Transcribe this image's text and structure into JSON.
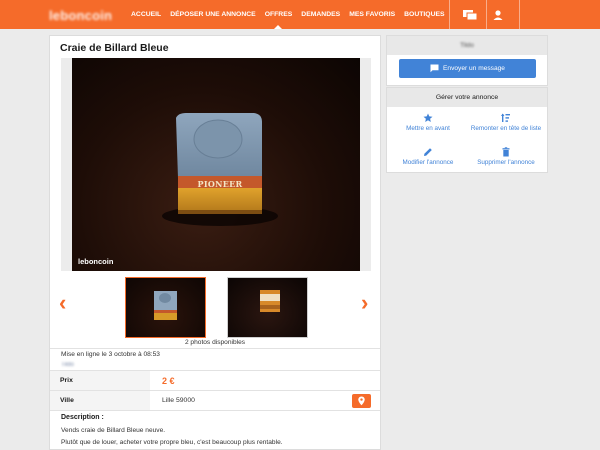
{
  "header": {
    "logo": "leboncoin",
    "nav": [
      "ACCUEIL",
      "DÉPOSER UNE ANNONCE",
      "OFFRES",
      "DEMANDES",
      "MES FAVORIS",
      "BOUTIQUES"
    ],
    "active_nav": "OFFRES",
    "icons": [
      "messages-icon",
      "user-icon"
    ]
  },
  "ad": {
    "title": "Craie de Billard Bleue",
    "photo_watermark": "leboncoin",
    "photo_text": "PIONEER",
    "photos_count": "2 photos disponibles",
    "published": "Mise en ligne le 3 octobre à 08:53",
    "seller_blur": "Tildo",
    "price_label": "Prix",
    "price": "2 €",
    "city_label": "Ville",
    "city": "Lille 59000",
    "description_title": "Description :",
    "description_lines": [
      "Vends craie de Billard Bleue neuve.",
      "Plutôt que de louer, acheter votre propre bleu, c'est beaucoup plus rentable."
    ]
  },
  "sidebar": {
    "seller_name": "Tildo",
    "message_button": "Envoyer un message",
    "manage_title": "Gérer votre annonce",
    "actions": [
      {
        "label": "Mettre en avant",
        "icon": "star-icon"
      },
      {
        "label": "Remonter en tête de liste",
        "icon": "sort-icon"
      },
      {
        "label": "Modifier l'annonce",
        "icon": "pencil-icon"
      },
      {
        "label": "Supprimer l'annonce",
        "icon": "trash-icon"
      }
    ]
  },
  "colors": {
    "brand": "#f56b2a",
    "link": "#4183d7"
  }
}
